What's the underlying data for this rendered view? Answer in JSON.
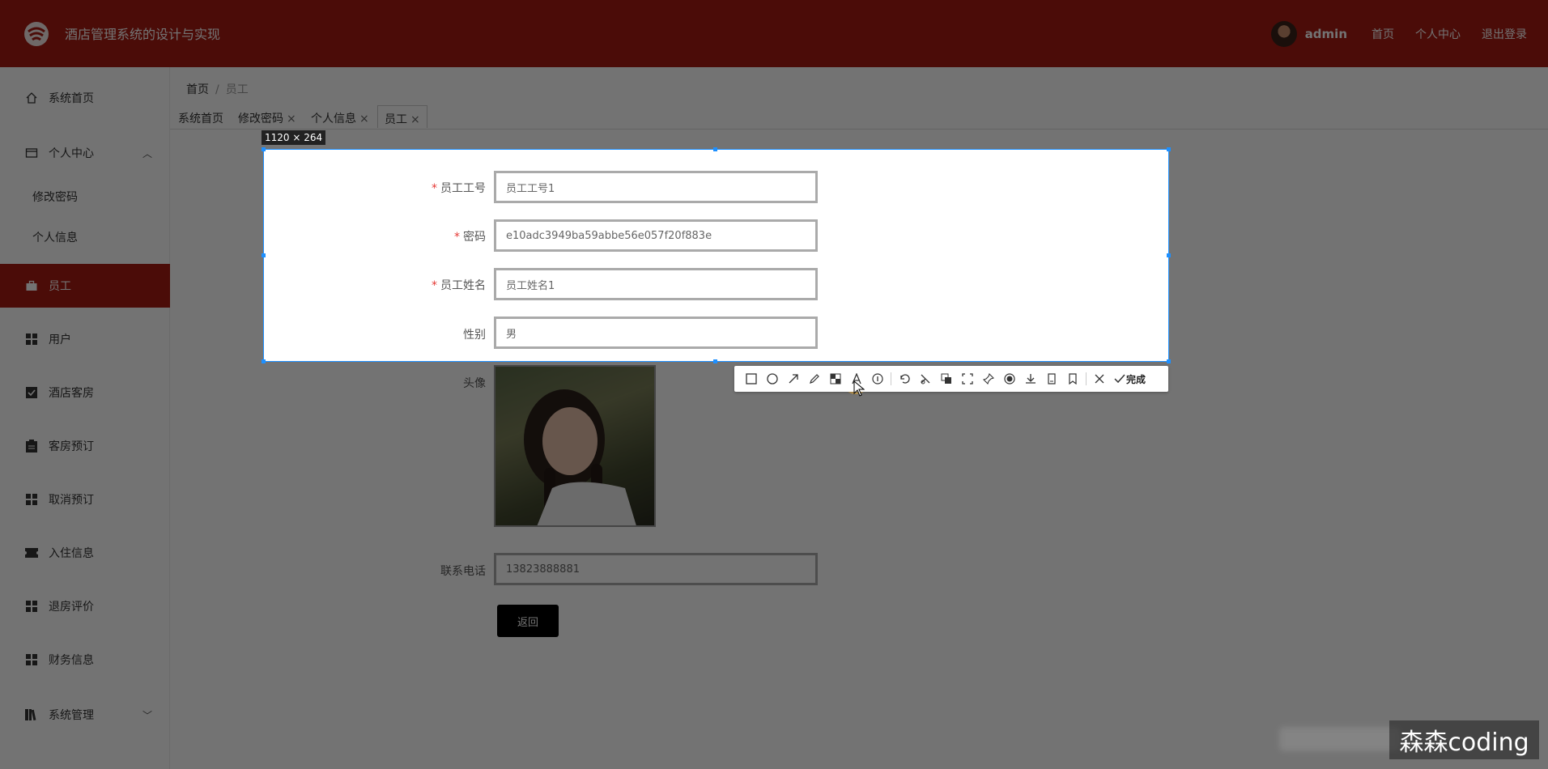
{
  "header": {
    "app_title": "酒店管理系统的设计与实现",
    "username": "admin",
    "links": [
      "首页",
      "个人中心",
      "退出登录"
    ]
  },
  "sidebar": {
    "items": [
      {
        "label": "系统首页",
        "icon": "home-icon"
      },
      {
        "label": "个人中心",
        "icon": "id-card-icon"
      },
      {
        "label": "修改密码"
      },
      {
        "label": "个人信息"
      },
      {
        "label": "员工",
        "icon": "briefcase-icon"
      },
      {
        "label": "用户",
        "icon": "grid-icon"
      },
      {
        "label": "酒店客房",
        "icon": "checkbox-icon"
      },
      {
        "label": "客房预订",
        "icon": "clipboard-icon"
      },
      {
        "label": "取消预订",
        "icon": "grid-icon"
      },
      {
        "label": "入住信息",
        "icon": "ticket-icon"
      },
      {
        "label": "退房评价",
        "icon": "grid-icon"
      },
      {
        "label": "财务信息",
        "icon": "grid-icon"
      },
      {
        "label": "系统管理",
        "icon": "books-icon"
      }
    ]
  },
  "breadcrumb": {
    "home": "首页",
    "current": "员工"
  },
  "tabs": [
    {
      "label": "系统首页",
      "closable": false
    },
    {
      "label": "修改密码",
      "closable": true
    },
    {
      "label": "个人信息",
      "closable": true
    },
    {
      "label": "员工",
      "closable": true,
      "active": true
    }
  ],
  "form": {
    "fields": [
      {
        "label": "员工工号",
        "required": true,
        "value": "员工工号1"
      },
      {
        "label": "密码",
        "required": true,
        "value": "e10adc3949ba59abbe56e057f20f883e"
      },
      {
        "label": "员工姓名",
        "required": true,
        "value": "员工姓名1"
      },
      {
        "label": "性别",
        "required": false,
        "value": "男"
      },
      {
        "label": "头像",
        "required": false
      },
      {
        "label": "联系电话",
        "required": false,
        "value": "13823888881"
      }
    ],
    "back_label": "返回"
  },
  "snip": {
    "size_text": "1120 × 264",
    "done_label": "完成",
    "tools": [
      "rectangle-icon",
      "ellipse-icon",
      "arrow-icon",
      "pencil-icon",
      "mosaic-icon",
      "text-icon",
      "serial-number-icon",
      "undo-icon",
      "redo-icon",
      "translate-icon",
      "scroll-capture-icon",
      "pin-icon",
      "record-icon",
      "download-icon",
      "long-screenshot-icon",
      "bookmark-icon",
      "close-icon",
      "check-icon"
    ],
    "accent": "#1e90ff"
  },
  "watermark": "森森coding",
  "colors": {
    "brand": "#a61b12"
  }
}
